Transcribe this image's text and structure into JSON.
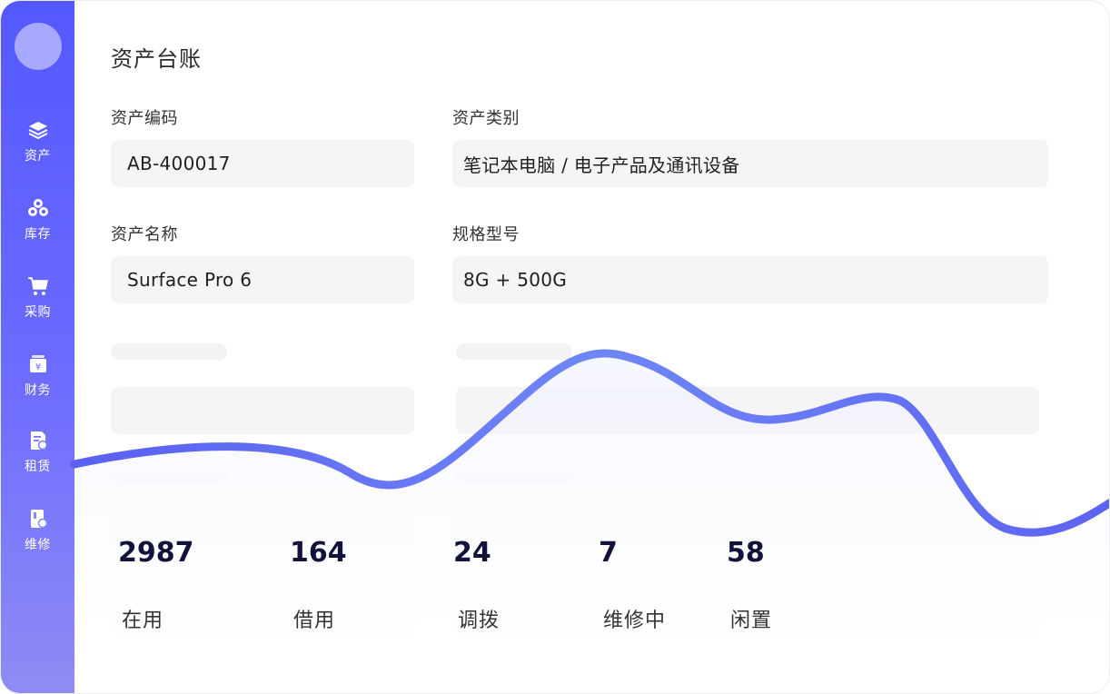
{
  "sidebar": {
    "items": [
      {
        "label": "资产",
        "icon": "layers-icon"
      },
      {
        "label": "库存",
        "icon": "cluster-icon"
      },
      {
        "label": "采购",
        "icon": "cart-icon"
      },
      {
        "label": "财务",
        "icon": "yen-box-icon"
      },
      {
        "label": "租赁",
        "icon": "document-lease-icon"
      },
      {
        "label": "维修",
        "icon": "repair-card-icon"
      }
    ],
    "colors": {
      "top": "#5458ff",
      "bottom": "#8f8cf4"
    }
  },
  "page": {
    "title": "资产台账"
  },
  "form": {
    "asset_code": {
      "label": "资产编码",
      "value": "AB-400017"
    },
    "asset_category": {
      "label": "资产类别",
      "value": "笔记本电脑 / 电子产品及通讯设备"
    },
    "asset_name": {
      "label": "资产名称",
      "value": "Surface Pro 6"
    },
    "spec_model": {
      "label": "规格型号",
      "value": "8G + 500G"
    }
  },
  "stats": [
    {
      "value": "2987",
      "label": "在用"
    },
    {
      "value": "164",
      "label": "借用"
    },
    {
      "value": "24",
      "label": "调拨"
    },
    {
      "value": "7",
      "label": "维修中"
    },
    {
      "value": "58",
      "label": "闲置"
    }
  ],
  "accent_color": "#5f66f2"
}
